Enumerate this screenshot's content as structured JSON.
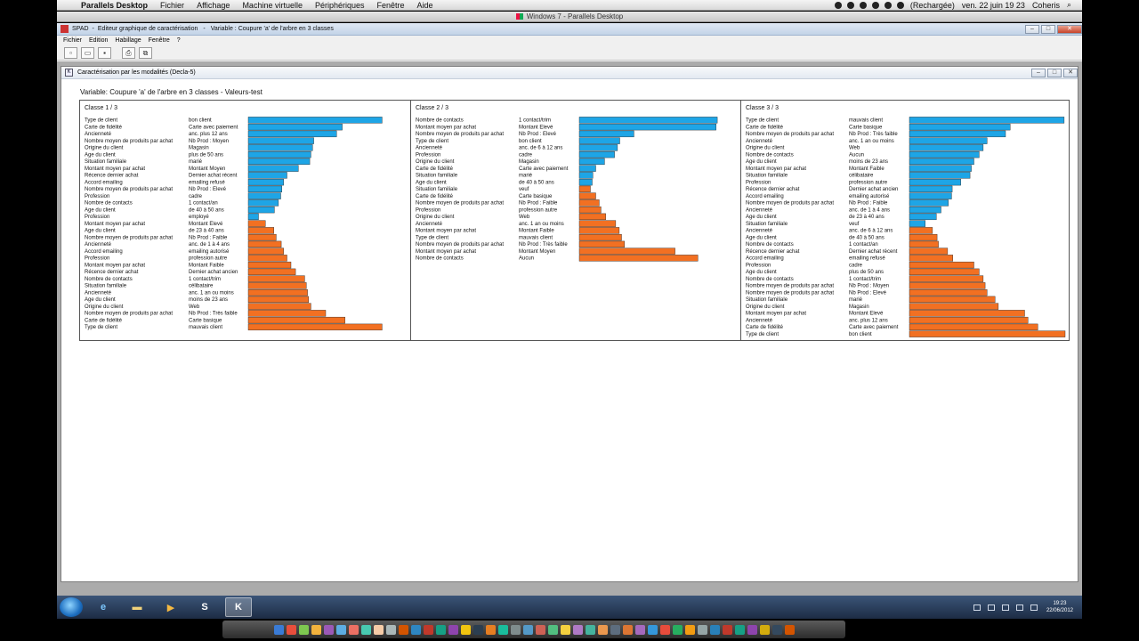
{
  "mac_menubar": {
    "items": [
      "Parallels Desktop",
      "Fichier",
      "Affichage",
      "Machine virtuelle",
      "Périphériques",
      "Fenêtre",
      "Aide"
    ],
    "status_battery": "(Rechargée)",
    "status_datetime": "ven. 22 juin  19 23",
    "status_user": "Coheris"
  },
  "pd_window": {
    "title": "Windows 7 - Parallels Desktop"
  },
  "spad_window": {
    "title_app": "SPAD",
    "title_doc": "Editeur graphique de caractérisation",
    "title_var": "Variable : Coupure 'a' de l'arbre en  3 classes",
    "menus": [
      "Fichier",
      "Edition",
      "Habillage",
      "Fenêtre",
      "?"
    ]
  },
  "child_window": {
    "title": "Caractérisation par les modalités  (Decla-5)",
    "variable_title": "Variable: Coupure 'a' de l'arbre en  3 classes  -  Valeurs-test"
  },
  "chart_data": {
    "type": "bar",
    "orientation": "horizontal",
    "grid": false,
    "legend": "none",
    "colors": {
      "positive": "#1ea5e6",
      "negative": "#f27022"
    },
    "panels": [
      {
        "title": "Classe  1 / 3",
        "rows": [
          {
            "var": "Type de client",
            "mod": "bon client",
            "value": 23.5
          },
          {
            "var": "Carte de fidélité",
            "mod": "Carte avec paiement",
            "value": 16.5
          },
          {
            "var": "Ancienneté",
            "mod": "anc. plus 12 ans",
            "value": 15.5
          },
          {
            "var": "Nombre moyen de produits par achat",
            "mod": "Nb Prod : Moyen",
            "value": 11.5
          },
          {
            "var": "Origine du client",
            "mod": "Magasin",
            "value": 11.3
          },
          {
            "var": "Age du client",
            "mod": "plus de 50 ans",
            "value": 11.0
          },
          {
            "var": "Situation familiale",
            "mod": "marié",
            "value": 10.8
          },
          {
            "var": "Montant moyen par achat",
            "mod": "Montant Moyen",
            "value": 8.8
          },
          {
            "var": "Récence dernier achat",
            "mod": "Dernier achat récent",
            "value": 6.8
          },
          {
            "var": "Accord emailing",
            "mod": "emailing refusé",
            "value": 6.2
          },
          {
            "var": "Nombre moyen de produits par achat",
            "mod": "Nb Prod : Elevé",
            "value": 5.9
          },
          {
            "var": "Profession",
            "mod": "cadre",
            "value": 5.7
          },
          {
            "var": "Nombre de contacts",
            "mod": "1 contact/an",
            "value": 5.3
          },
          {
            "var": "Age du client",
            "mod": "de 40 à 50 ans",
            "value": 4.6
          },
          {
            "var": "Profession",
            "mod": "employé",
            "value": 1.8
          },
          {
            "var": "Montant moyen par achat",
            "mod": "Montant Elevé",
            "value": -3.0
          },
          {
            "var": "Age du client",
            "mod": "de 23 à 40 ans",
            "value": -4.5
          },
          {
            "var": "Nombre moyen de produits par achat",
            "mod": "Nb Prod : Faible",
            "value": -4.9
          },
          {
            "var": "Ancienneté",
            "mod": "anc. de 1 à 4 ans",
            "value": -5.8
          },
          {
            "var": "Accord emailing",
            "mod": "emailing autorisé",
            "value": -6.2
          },
          {
            "var": "Profession",
            "mod": "profession autre",
            "value": -6.8
          },
          {
            "var": "Montant moyen par achat",
            "mod": "Montant Faible",
            "value": -7.5
          },
          {
            "var": "Récence dernier achat",
            "mod": "Dernier achat ancien",
            "value": -8.3
          },
          {
            "var": "Nombre de contacts",
            "mod": "1 contact/trim",
            "value": -9.9
          },
          {
            "var": "Situation familiale",
            "mod": "célibataire",
            "value": -10.2
          },
          {
            "var": "Ancienneté",
            "mod": "anc. 1 an ou moins",
            "value": -10.4
          },
          {
            "var": "Age du client",
            "mod": "moins de 23 ans",
            "value": -10.6
          },
          {
            "var": "Origine du client",
            "mod": "Web",
            "value": -11.0
          },
          {
            "var": "Nombre moyen de produits par achat",
            "mod": "Nb Prod : Très faible",
            "value": -13.6
          },
          {
            "var": "Carte de fidélité",
            "mod": "Carte basique",
            "value": -17.0
          },
          {
            "var": "Type de client",
            "mod": "mauvais client",
            "value": -23.5
          }
        ]
      },
      {
        "title": "Classe  2 / 3",
        "rows": [
          {
            "var": "Nombre de contacts",
            "mod": "1 contact/trim",
            "value": 23.5
          },
          {
            "var": "Montant moyen par achat",
            "mod": "Montant Elevé",
            "value": 23.3
          },
          {
            "var": "Nombre moyen de produits par achat",
            "mod": "Nb Prod : Elevé",
            "value": 9.3
          },
          {
            "var": "Type de client",
            "mod": "bon client",
            "value": 6.9
          },
          {
            "var": "Ancienneté",
            "mod": "anc. de 6 à 12 ans",
            "value": 6.5
          },
          {
            "var": "Profession",
            "mod": "cadre",
            "value": 6.0
          },
          {
            "var": "Origine du client",
            "mod": "Magasin",
            "value": 4.3
          },
          {
            "var": "Carte de fidélité",
            "mod": "Carte avec paiement",
            "value": 2.8
          },
          {
            "var": "Situation familiale",
            "mod": "marié",
            "value": 2.3
          },
          {
            "var": "Age du client",
            "mod": "de 40 à 50 ans",
            "value": 2.2
          },
          {
            "var": "Situation familiale",
            "mod": "veuf",
            "value": -1.9
          },
          {
            "var": "Carte de fidélité",
            "mod": "Carte basique",
            "value": -2.8
          },
          {
            "var": "Nombre moyen de produits par achat",
            "mod": "Nb Prod : Faible",
            "value": -3.4
          },
          {
            "var": "Profession",
            "mod": "profession autre",
            "value": -3.7
          },
          {
            "var": "Origine du client",
            "mod": "Web",
            "value": -4.5
          },
          {
            "var": "Ancienneté",
            "mod": "anc. 1 an ou moins",
            "value": -6.2
          },
          {
            "var": "Montant moyen par achat",
            "mod": "Montant Faible",
            "value": -6.8
          },
          {
            "var": "Type de client",
            "mod": "mauvais client",
            "value": -7.2
          },
          {
            "var": "Nombre moyen de produits par achat",
            "mod": "Nb Prod : Très faible",
            "value": -7.7
          },
          {
            "var": "Montant moyen par achat",
            "mod": "Montant Moyen",
            "value": -16.3
          },
          {
            "var": "Nombre de contacts",
            "mod": "Aucun",
            "value": -20.2
          }
        ]
      },
      {
        "title": "Classe  3 / 3",
        "rows": [
          {
            "var": "Type de client",
            "mod": "mauvais client",
            "value": 23.5
          },
          {
            "var": "Carte de fidélité",
            "mod": "Carte basique",
            "value": 15.3
          },
          {
            "var": "Nombre moyen de produits par achat",
            "mod": "Nb Prod : Très faible",
            "value": 14.6
          },
          {
            "var": "Ancienneté",
            "mod": "anc. 1 an ou moins",
            "value": 11.8
          },
          {
            "var": "Origine du client",
            "mod": "Web",
            "value": 11.2
          },
          {
            "var": "Nombre de contacts",
            "mod": "Aucun",
            "value": 10.6
          },
          {
            "var": "Age du client",
            "mod": "moins de 23 ans",
            "value": 9.8
          },
          {
            "var": "Montant moyen par achat",
            "mod": "Montant Faible",
            "value": 9.4
          },
          {
            "var": "Situation familiale",
            "mod": "célibataire",
            "value": 9.2
          },
          {
            "var": "Profession",
            "mod": "profession autre",
            "value": 7.8
          },
          {
            "var": "Récence dernier achat",
            "mod": "Dernier achat ancien",
            "value": 6.5
          },
          {
            "var": "Accord emailing",
            "mod": "emailing autorisé",
            "value": 6.4
          },
          {
            "var": "Nombre moyen de produits par achat",
            "mod": "Nb Prod : Faible",
            "value": 5.9
          },
          {
            "var": "Ancienneté",
            "mod": "anc. de 1 à 4 ans",
            "value": 4.8
          },
          {
            "var": "Age du client",
            "mod": "de 23 à 40 ans",
            "value": 4.1
          },
          {
            "var": "Situation familiale",
            "mod": "veuf",
            "value": 2.4
          },
          {
            "var": "Ancienneté",
            "mod": "anc. de 6 à 12 ans",
            "value": -3.5
          },
          {
            "var": "Age du client",
            "mod": "de 40 à 50 ans",
            "value": -4.2
          },
          {
            "var": "Nombre de contacts",
            "mod": "1 contact/an",
            "value": -4.4
          },
          {
            "var": "Récence dernier achat",
            "mod": "Dernier achat récent",
            "value": -5.8
          },
          {
            "var": "Accord emailing",
            "mod": "emailing refusé",
            "value": -6.6
          },
          {
            "var": "Profession",
            "mod": "cadre",
            "value": -9.8
          },
          {
            "var": "Age du client",
            "mod": "plus de 50 ans",
            "value": -10.6
          },
          {
            "var": "Nombre de contacts",
            "mod": "1 contact/trim",
            "value": -11.2
          },
          {
            "var": "Nombre moyen de produits par achat",
            "mod": "Nb Prod : Moyen",
            "value": -11.5
          },
          {
            "var": "Nombre moyen de produits par achat",
            "mod": "Nb Prod : Elevé",
            "value": -11.8
          },
          {
            "var": "Situation familiale",
            "mod": "marié",
            "value": -13.0
          },
          {
            "var": "Origine du client",
            "mod": "Magasin",
            "value": -13.5
          },
          {
            "var": "Montant moyen par achat",
            "mod": "Montant Elevé",
            "value": -17.5
          },
          {
            "var": "Ancienneté",
            "mod": "anc. plus 12 ans",
            "value": -18.0
          },
          {
            "var": "Carte de fidélité",
            "mod": "Carte avec paiement",
            "value": -19.5
          },
          {
            "var": "Type de client",
            "mod": "bon client",
            "value": -27.5
          }
        ]
      }
    ]
  },
  "taskbar": {
    "clock_time": "19:23",
    "clock_date": "22/06/2012"
  }
}
